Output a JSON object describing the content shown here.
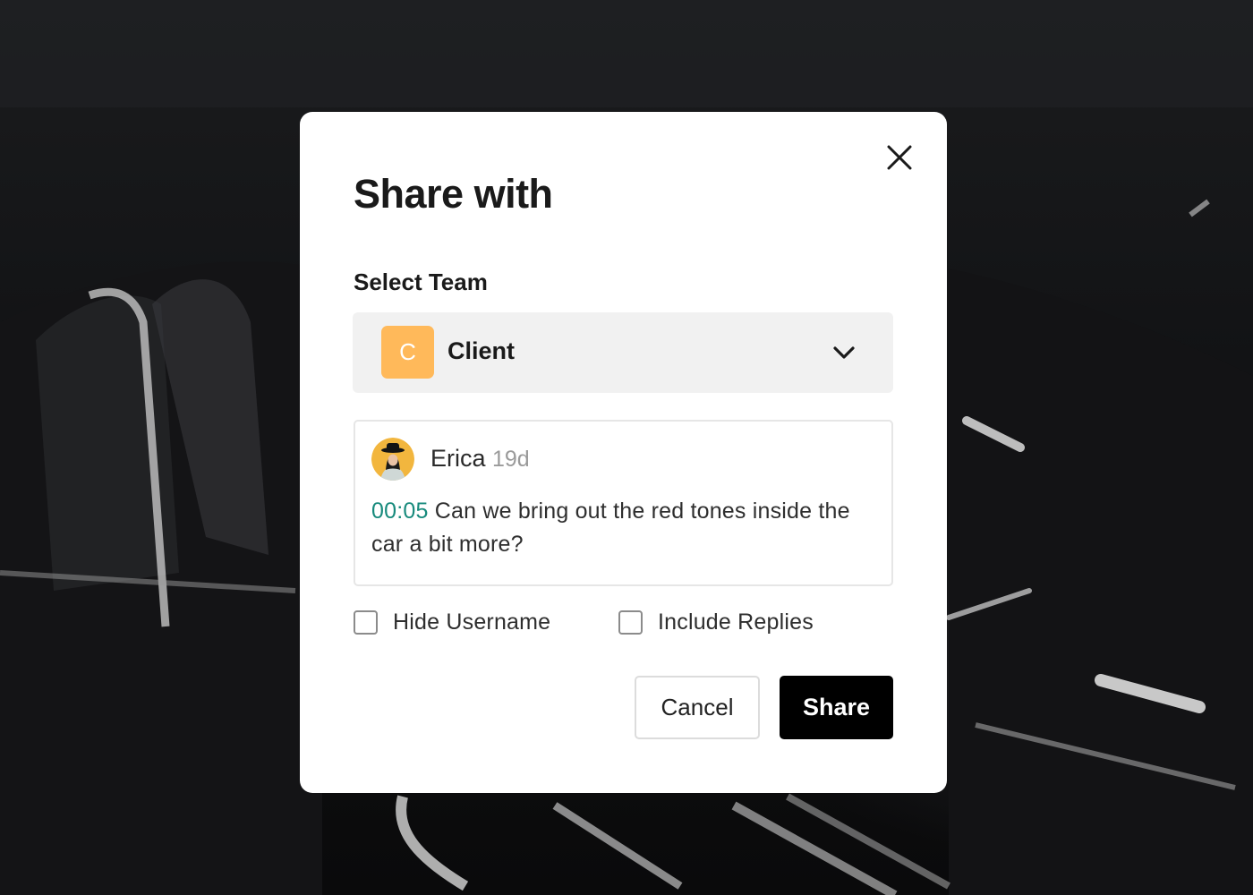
{
  "modal": {
    "title": "Share with",
    "close_icon": "close-icon"
  },
  "team_select": {
    "label": "Select Team",
    "selected": {
      "initial": "C",
      "name": "Client",
      "avatar_color": "#ffb95a"
    },
    "dropdown_icon": "chevron-down-icon"
  },
  "comment": {
    "author": "Erica",
    "age": "19d",
    "timestamp": "00:05",
    "text": "Can we bring out the red tones inside the car a bit more?",
    "timestamp_color": "#178a7c"
  },
  "options": {
    "hide_username": {
      "label": "Hide Username",
      "checked": false
    },
    "include_replies": {
      "label": "Include Replies",
      "checked": false
    }
  },
  "actions": {
    "cancel_label": "Cancel",
    "share_label": "Share"
  }
}
